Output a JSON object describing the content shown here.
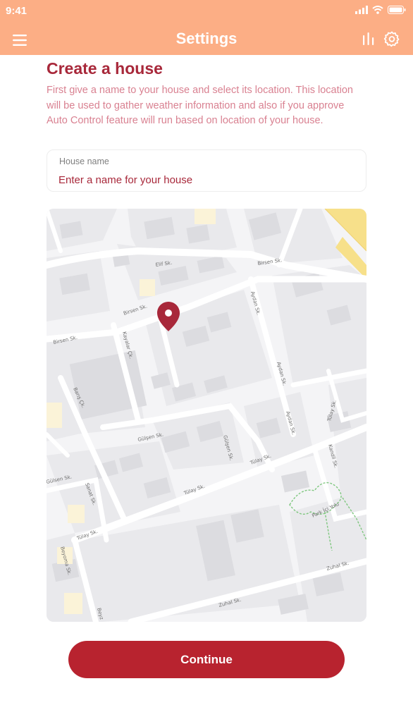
{
  "status_bar": {
    "time": "9:41"
  },
  "app_bar": {
    "title": "Settings",
    "icons": [
      "menu-icon",
      "bar-chart-icon",
      "gear-icon"
    ]
  },
  "heading": "Create a house",
  "description": "First give a name to your house and select its location. This location will be used to gather weather information and also if you approve Auto Control feature will run based on location of your house.",
  "house_name_field": {
    "label": "House name",
    "value": "",
    "placeholder": "Enter a name for your house"
  },
  "map": {
    "pin_icon": "location-pin-icon",
    "streets": [
      "Elif Sk.",
      "Birsen Sk.",
      "Birsen Sk.",
      "Birsen Sk.",
      "Kayalar Çk.",
      "Aydan Sk.",
      "Aydan Sk.",
      "Aydan Sk.",
      "Barış Çk.",
      "Gülşen Sk.",
      "Gülşen Sk.",
      "Tülay Sk.",
      "Tülay Sk.",
      "Tülay Sk.",
      "Tülay Sk.",
      "Gülsen Sk.",
      "Sanat Sk.",
      "Kandil Sk.",
      "Park İçi Yolu",
      "Zuhal Sk.",
      "Zuhal Sk.",
      "Beyoma Sk.",
      "Beyz"
    ],
    "colors": {
      "background": "#F4F4F6",
      "block": "#E9E9EC",
      "building": "#DCDCE0",
      "road": "#FFFFFF",
      "highway": "#F7E08A",
      "park_path": "#7FC77F",
      "pin": "#A8283A"
    }
  },
  "continue_button": {
    "label": "Continue"
  },
  "colors": {
    "header": "#FCAE85",
    "accent": "#A8283A",
    "button": "#B8232F",
    "description_text": "#D98191"
  }
}
